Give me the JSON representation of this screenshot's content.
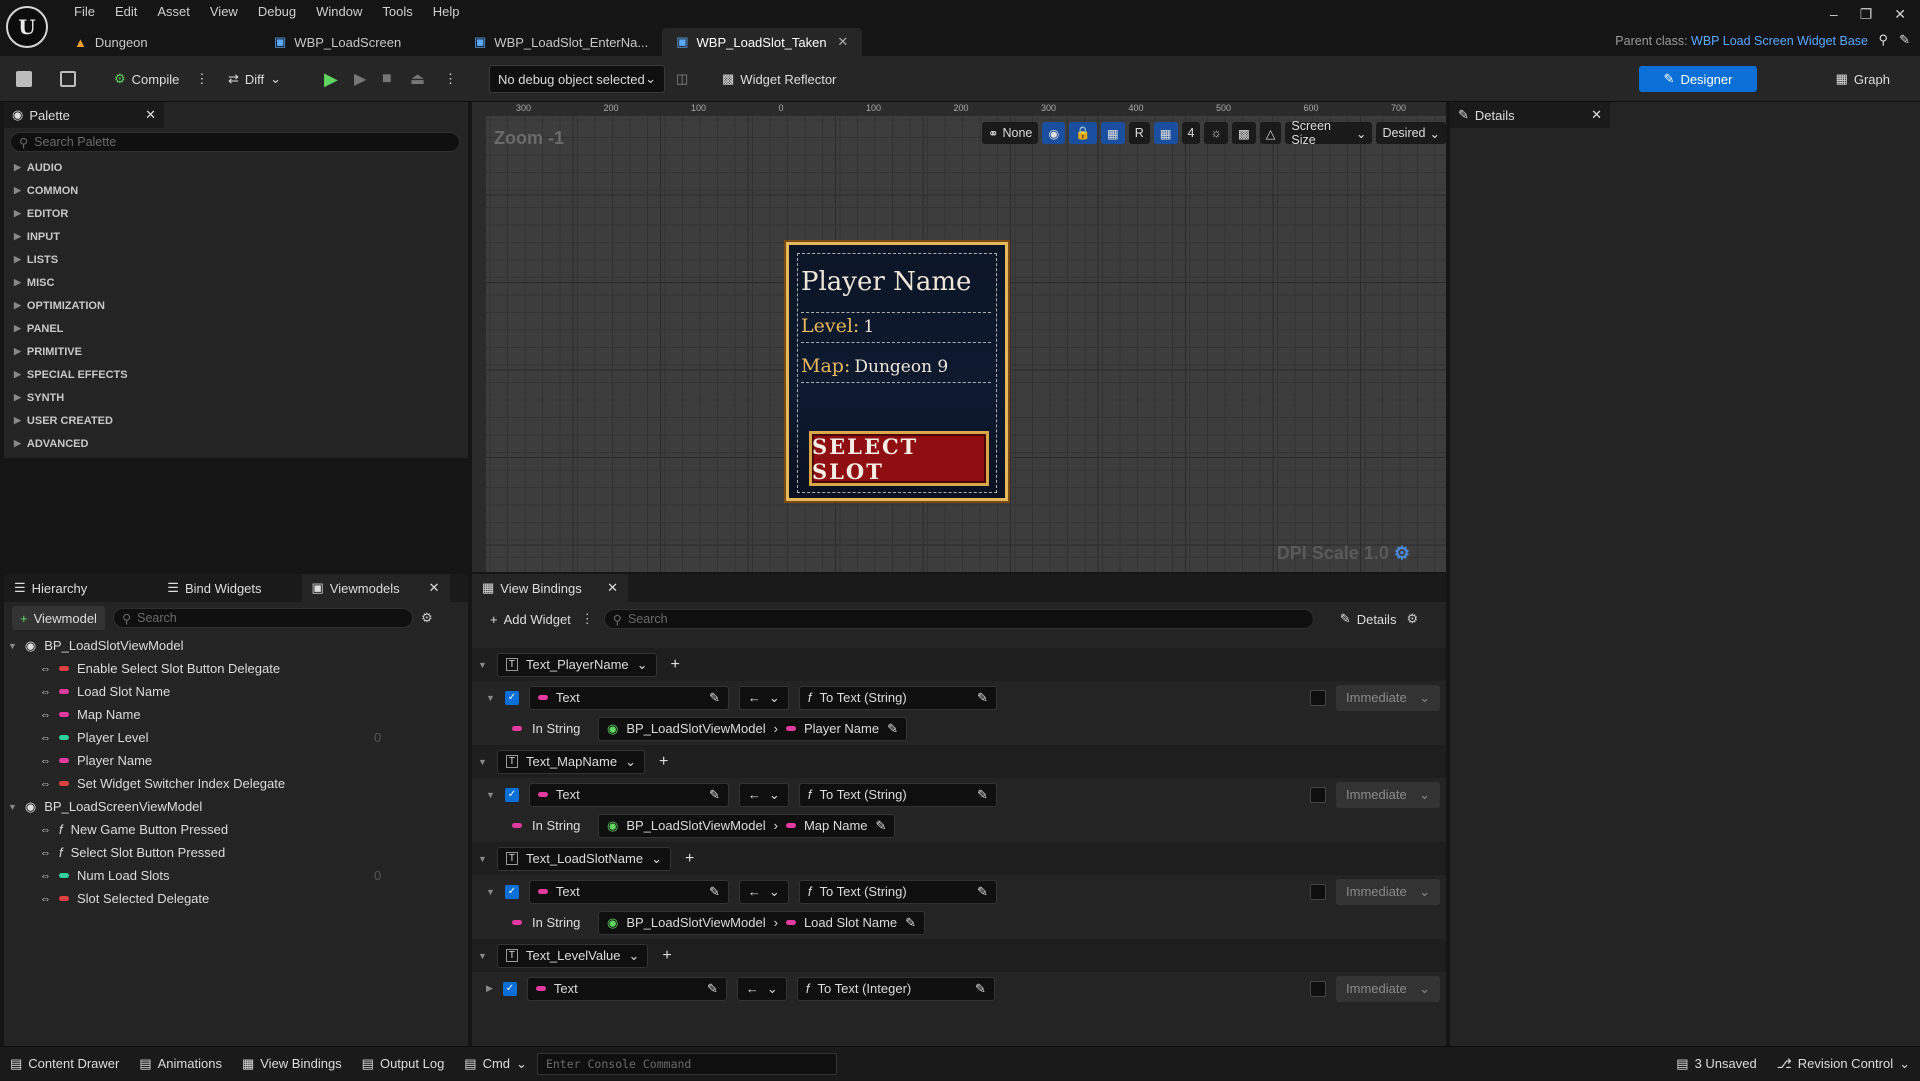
{
  "menu": [
    "File",
    "Edit",
    "Asset",
    "View",
    "Debug",
    "Window",
    "Tools",
    "Help"
  ],
  "tabs": [
    {
      "label": "Dungeon"
    },
    {
      "label": "WBP_LoadScreen"
    },
    {
      "label": "WBP_LoadSlot_EnterNa..."
    },
    {
      "label": "WBP_LoadSlot_Taken"
    }
  ],
  "parent": {
    "prefix": "Parent class:",
    "value": "WBP Load Screen Widget Base"
  },
  "toolbar": {
    "compile": "Compile",
    "diff": "Diff",
    "debug": "No debug object selected",
    "reflector": "Widget Reflector",
    "designer": "Designer",
    "graph": "Graph"
  },
  "palette": {
    "title": "Palette",
    "search": "Search Palette",
    "categories": [
      "AUDIO",
      "COMMON",
      "EDITOR",
      "INPUT",
      "LISTS",
      "MISC",
      "OPTIMIZATION",
      "PANEL",
      "PRIMITIVE",
      "SPECIAL EFFECTS",
      "SYNTH",
      "USER CREATED",
      "ADVANCED"
    ]
  },
  "details": {
    "title": "Details"
  },
  "canvas": {
    "zoom": "Zoom -1",
    "none": "None",
    "r": "R",
    "grid": "4",
    "screen_size": "Screen Size",
    "desired": "Desired",
    "dpi": "DPI Scale 1.0",
    "ruler": [
      "300",
      "200",
      "100",
      "0",
      "100",
      "200",
      "300",
      "400",
      "500",
      "600",
      "700"
    ]
  },
  "card": {
    "player_name": "Player Name",
    "level_label": "Level:",
    "level_value": "1",
    "map_label": "Map:",
    "map_value": "Dungeon 9",
    "button": "SELECT SLOT"
  },
  "left_tabs": {
    "hierarchy": "Hierarchy",
    "bind": "Bind Widgets",
    "viewmodels": "Viewmodels"
  },
  "vm": {
    "add": "Viewmodel",
    "search": "Search",
    "groups": [
      {
        "name": "BP_LoadSlotViewModel",
        "items": [
          {
            "label": "Enable Select Slot Button Delegate",
            "color": "#e04040",
            "value": ""
          },
          {
            "label": "Load Slot Name",
            "color": "#e23aa0",
            "value": ""
          },
          {
            "label": "Map Name",
            "color": "#e23aa0",
            "value": ""
          },
          {
            "label": "Player Level",
            "color": "#2fd0a0",
            "value": "0"
          },
          {
            "label": "Player Name",
            "color": "#e23aa0",
            "value": ""
          },
          {
            "label": "Set Widget Switcher Index Delegate",
            "color": "#e04040",
            "value": ""
          }
        ]
      },
      {
        "name": "BP_LoadScreenViewModel",
        "items": [
          {
            "label": "New Game Button Pressed",
            "color": "",
            "value": ""
          },
          {
            "label": "Select Slot Button Pressed",
            "color": "",
            "value": ""
          },
          {
            "label": "Num Load Slots",
            "color": "#2fd0a0",
            "value": "0"
          },
          {
            "label": "Slot Selected Delegate",
            "color": "#e04040",
            "value": ""
          }
        ]
      }
    ]
  },
  "vb": {
    "title": "View Bindings",
    "add_widget": "Add Widget",
    "search": "Search",
    "details": "Details",
    "groups": [
      {
        "widget": "Text_PlayerName",
        "prop": "Text",
        "func": "To Text (String)",
        "mode": "Immediate",
        "input": "In String",
        "vm": "BP_LoadSlotViewModel",
        "field": "Player Name"
      },
      {
        "widget": "Text_MapName",
        "prop": "Text",
        "func": "To Text (String)",
        "mode": "Immediate",
        "input": "In String",
        "vm": "BP_LoadSlotViewModel",
        "field": "Map Name"
      },
      {
        "widget": "Text_LoadSlotName",
        "prop": "Text",
        "func": "To Text (String)",
        "mode": "Immediate",
        "input": "In String",
        "vm": "BP_LoadSlotViewModel",
        "field": "Load Slot Name"
      },
      {
        "widget": "Text_LevelValue",
        "prop": "Text",
        "func": "To Text (Integer)",
        "mode": "Immediate"
      }
    ]
  },
  "status": {
    "content_drawer": "Content Drawer",
    "animations": "Animations",
    "view_bindings": "View Bindings",
    "output_log": "Output Log",
    "cmd": "Cmd",
    "console": "Enter Console Command",
    "unsaved": "3 Unsaved",
    "revision": "Revision Control"
  }
}
